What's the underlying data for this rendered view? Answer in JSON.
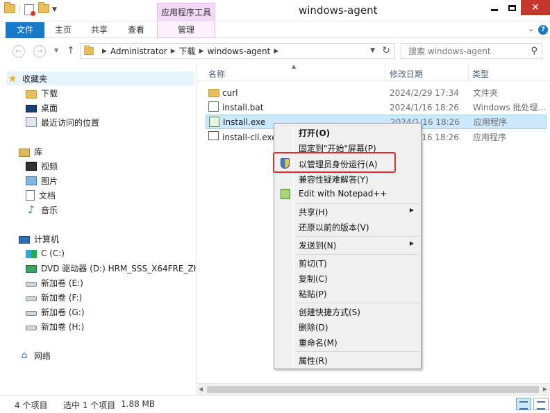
{
  "titlebar": {
    "title": "windows-agent",
    "context_tab_header": "应用程序工具"
  },
  "ribbon": {
    "file_tab": "文件",
    "tabs": [
      "主页",
      "共享",
      "查看",
      "管理"
    ]
  },
  "address": {
    "crumbs": [
      "Administrator",
      "下载",
      "windows-agent"
    ],
    "search_placeholder": "搜索 windows-agent"
  },
  "nav": {
    "favorites": "收藏夹",
    "downloads": "下载",
    "desktop": "桌面",
    "recent": "最近访问的位置",
    "libraries": "库",
    "videos": "视频",
    "pictures": "图片",
    "documents": "文档",
    "music": "音乐",
    "computer": "计算机",
    "drive_c": "C (C:)",
    "drive_d": "DVD 驱动器 (D:) HRM_SSS_X64FRE_ZH-",
    "drive_e": "新加卷 (E:)",
    "drive_f": "新加卷 (F:)",
    "drive_g": "新加卷 (G:)",
    "drive_h": "新加卷 (H:)",
    "network": "网络"
  },
  "columns": {
    "name": "名称",
    "date": "修改日期",
    "type": "类型"
  },
  "files": [
    {
      "name": "curl",
      "date": "2024/2/29 17:34",
      "type": "文件夹",
      "icon": "folder-icon"
    },
    {
      "name": "install.bat",
      "date": "2024/1/16 18:26",
      "type": "Windows 批处理...",
      "icon": "batch-file-icon"
    },
    {
      "name": "Install.exe",
      "date": "2024/1/16 18:26",
      "type": "应用程序",
      "icon": "installer-exe-icon"
    },
    {
      "name": "install-cli.exe",
      "date": "2024/1/16 18:26",
      "type": "应用程序",
      "icon": "console-exe-icon"
    }
  ],
  "context_menu": {
    "open": "打开(O)",
    "pin_start": "固定到\"开始\"屏幕(P)",
    "run_as_admin": "以管理员身份运行(A)",
    "compat": "兼容性疑难解答(Y)",
    "notepad": "Edit with Notepad++",
    "share": "共享(H)",
    "restore": "还原以前的版本(V)",
    "send_to": "发送到(N)",
    "cut": "剪切(T)",
    "copy": "复制(C)",
    "paste": "粘贴(P)",
    "shortcut": "创建快捷方式(S)",
    "delete": "删除(D)",
    "rename": "重命名(M)",
    "properties": "属性(R)"
  },
  "status": {
    "item_count": "4 个项目",
    "selection": "选中 1 个项目",
    "size": "1.88 MB"
  },
  "colors": {
    "accent": "#1979ca",
    "context_tab": "#f3d9f7",
    "close_button": "#c7362c",
    "selection": "#cce8ff",
    "highlight_box": "#e52b2b"
  }
}
